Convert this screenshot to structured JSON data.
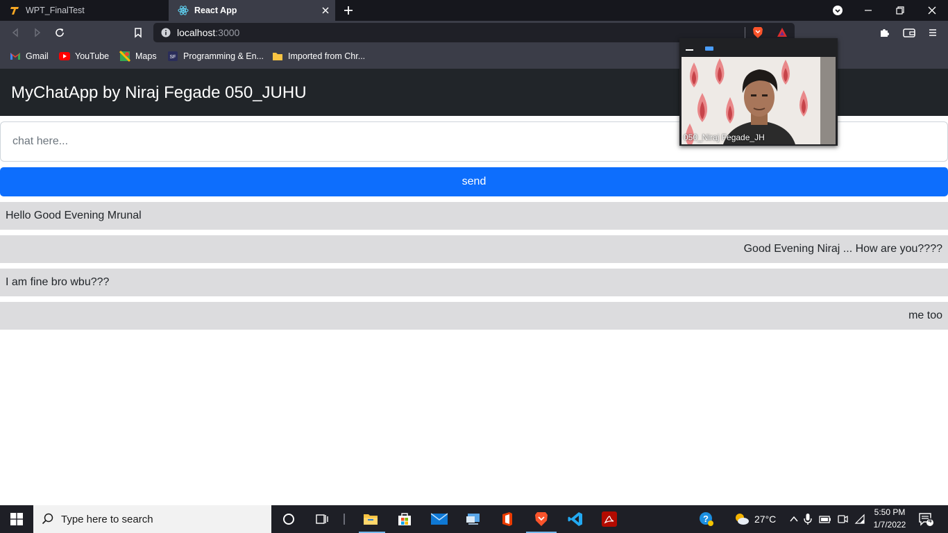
{
  "browser": {
    "tabs": [
      {
        "title": "WPT_FinalTest",
        "active": false
      },
      {
        "title": "React App",
        "active": true
      }
    ],
    "url_host": "localhost",
    "url_port": ":3000",
    "bookmarks": [
      {
        "label": "Gmail",
        "icon": "gmail-icon"
      },
      {
        "label": "YouTube",
        "icon": "youtube-icon"
      },
      {
        "label": "Maps",
        "icon": "maps-icon"
      },
      {
        "label": "Programming & En...",
        "icon": "bookmark-site-icon"
      },
      {
        "label": "Imported from Chr...",
        "icon": "folder-icon"
      }
    ]
  },
  "app": {
    "title": "MyChatApp by Niraj Fegade 050_JUHU",
    "input_placeholder": "chat here...",
    "input_value": "",
    "send_label": "send",
    "messages": [
      {
        "text": "Hello Good Evening Mrunal",
        "align": "left"
      },
      {
        "text": "Good Evening Niraj ... How are you????",
        "align": "right"
      },
      {
        "text": "I am fine bro wbu???",
        "align": "left"
      },
      {
        "text": "me too",
        "align": "right"
      }
    ]
  },
  "pip": {
    "participant_name": "050_Niraj Fegade_JH"
  },
  "taskbar": {
    "search_placeholder": "Type here to search",
    "weather_temp": "27°C",
    "time": "5:50 PM",
    "date": "1/7/2022",
    "notification_count": "4"
  },
  "colors": {
    "app_header_bg": "#212529",
    "send_button_bg": "#0d6efd",
    "message_bg": "#dcdcde",
    "browser_chrome_bg": "#3b3d48"
  }
}
